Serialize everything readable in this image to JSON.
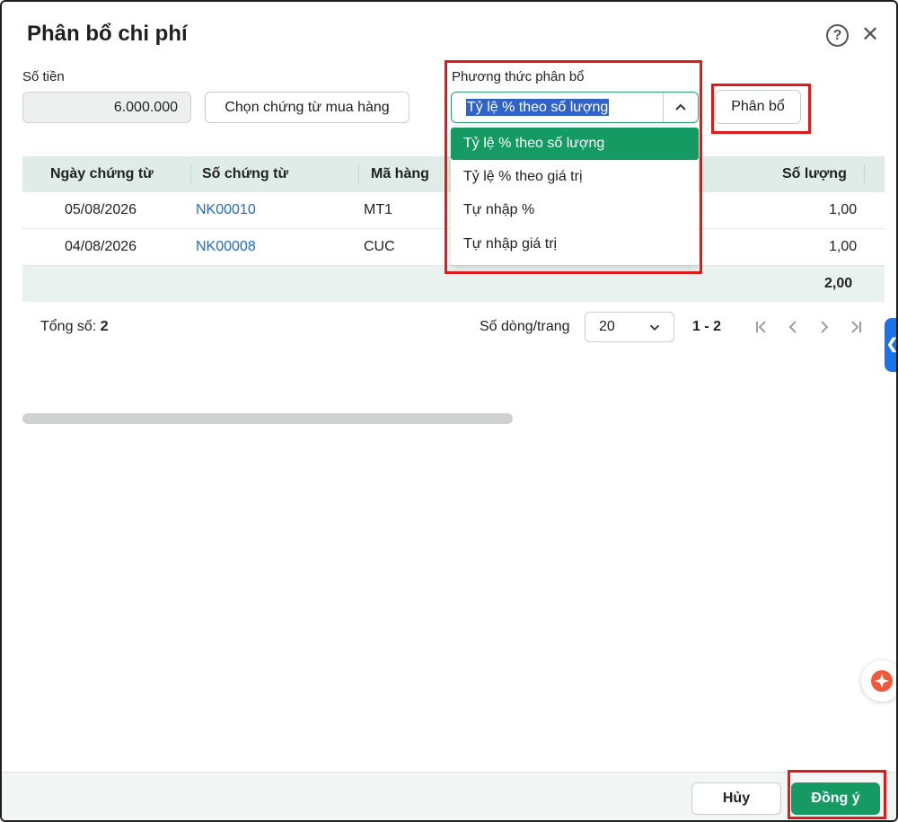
{
  "dialog": {
    "title": "Phân bổ chi phí",
    "help_glyph": "?",
    "close_glyph": "✕"
  },
  "amount": {
    "label": "Số tiền",
    "value": "6.000.000"
  },
  "choose_voucher_button": "Chọn chứng từ mua hàng",
  "method": {
    "label": "Phương thức phân bổ",
    "selected": "Tỷ lệ % theo số lượng",
    "options": [
      "Tỷ lệ % theo số lượng",
      "Tỷ lệ % theo giá trị",
      "Tự nhập %",
      "Tự nhập giá trị"
    ]
  },
  "allocate_button": "Phân bổ",
  "table": {
    "headers": [
      "Ngày chứng từ",
      "Số chứng từ",
      "Mã hàng",
      "Số lượng"
    ],
    "rows": [
      {
        "date": "05/08/2026",
        "voucher": "NK00010",
        "item": "MT1",
        "qty": "1,00"
      },
      {
        "date": "04/08/2026",
        "voucher": "NK00008",
        "item": "CUC",
        "qty": "1,00"
      }
    ],
    "total_qty": "2,00"
  },
  "pager": {
    "total_label": "Tổng số:",
    "total_value": "2",
    "rows_per_page_label": "Số dòng/trang",
    "rows_per_page": "20",
    "range": "1 - 2"
  },
  "side_tab_glyph": "❮",
  "footer": {
    "cancel": "Hủy",
    "ok": "Đồng ý"
  },
  "colors": {
    "primary_green": "#149a62",
    "highlight_red": "#e01a1a",
    "link_blue": "#1a6dd0",
    "header_bg": "#dfece7"
  }
}
